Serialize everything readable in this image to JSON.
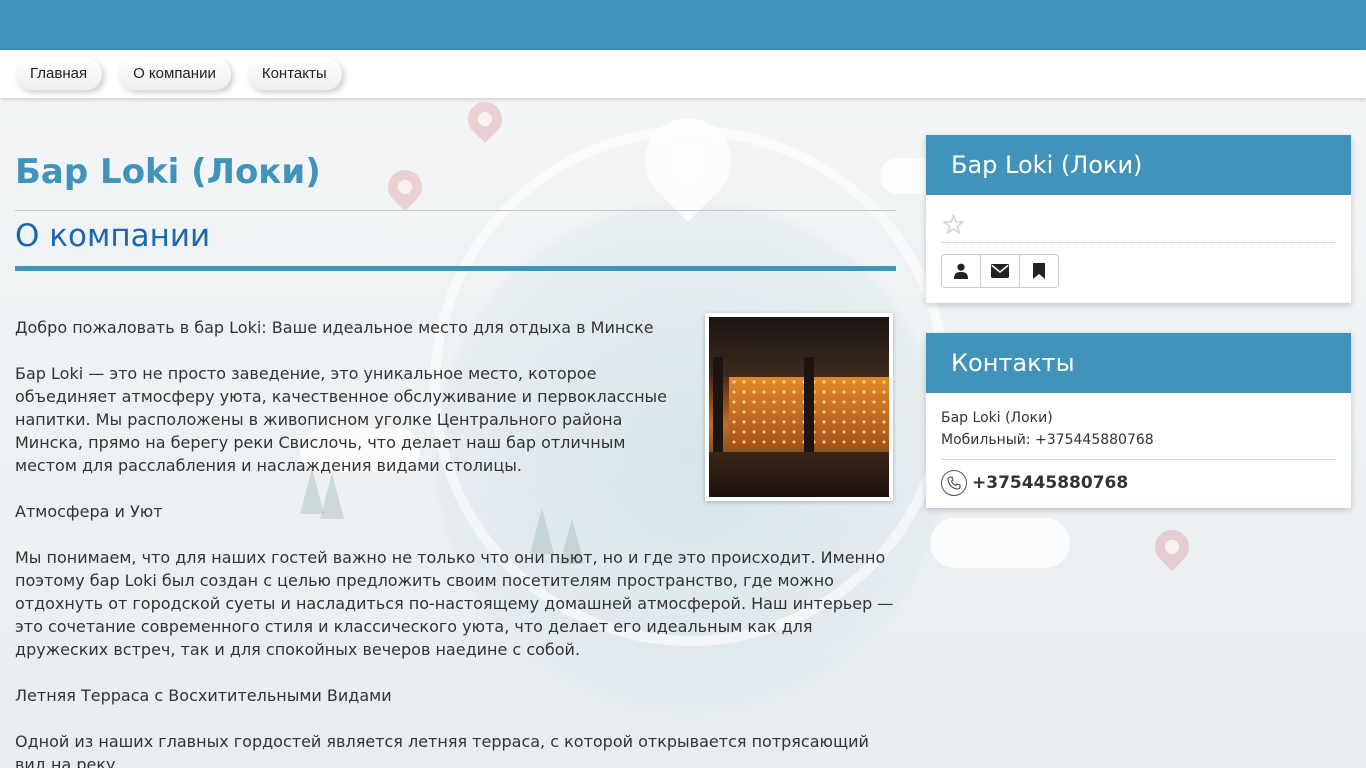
{
  "nav": {
    "items": [
      "Главная",
      "О компании",
      "Контакты"
    ]
  },
  "page": {
    "title": "Бар Loki (Локи)",
    "section_title": "О компании"
  },
  "article": {
    "paragraphs": [
      "Добро пожаловать в бар Loki: Ваше идеальное место для отдыха в Минске",
      "Бар Loki — это не просто заведение, это уникальное место, которое объединяет атмосферу уюта, качественное обслуживание и первоклассные напитки. Мы расположены в живописном уголке Центрального района Минска, прямо на берегу реки Свислочь, что делает наш бар отличным местом для расслабления и наслаждения видами столицы.",
      "Атмосфера и Уют",
      "Мы понимаем, что для наших гостей важно не только что они пьют, но и где это происходит. Именно поэтому бар Loki был создан с целью предложить своим посетителям пространство, где можно отдохнуть от городской суеты и насладиться по-настоящему домашней атмосферой. Наш интерьер — это сочетание современного стиля и классического уюта, что делает его идеальным как для дружеских встреч, так и для спокойных вечеров наедине с собой.",
      "Летняя Терраса с Восхитительными Видами",
      "Одной из наших главных гордостей является летняя терраса, с которой открывается потрясающий вид на реку ..."
    ]
  },
  "sidebar": {
    "company_card": {
      "title": "Бар Loki (Локи)",
      "rating_icon": "star-icon",
      "buttons": [
        "user-icon",
        "envelope-icon",
        "bookmark-icon"
      ]
    },
    "contacts_card": {
      "title": "Контакты",
      "name": "Бар Loki (Локи)",
      "mobile_line": "Мобильный: +375445880768",
      "phone": "+375445880768"
    }
  },
  "colors": {
    "primary": "#4193b9",
    "section_title": "#1e67a8"
  }
}
